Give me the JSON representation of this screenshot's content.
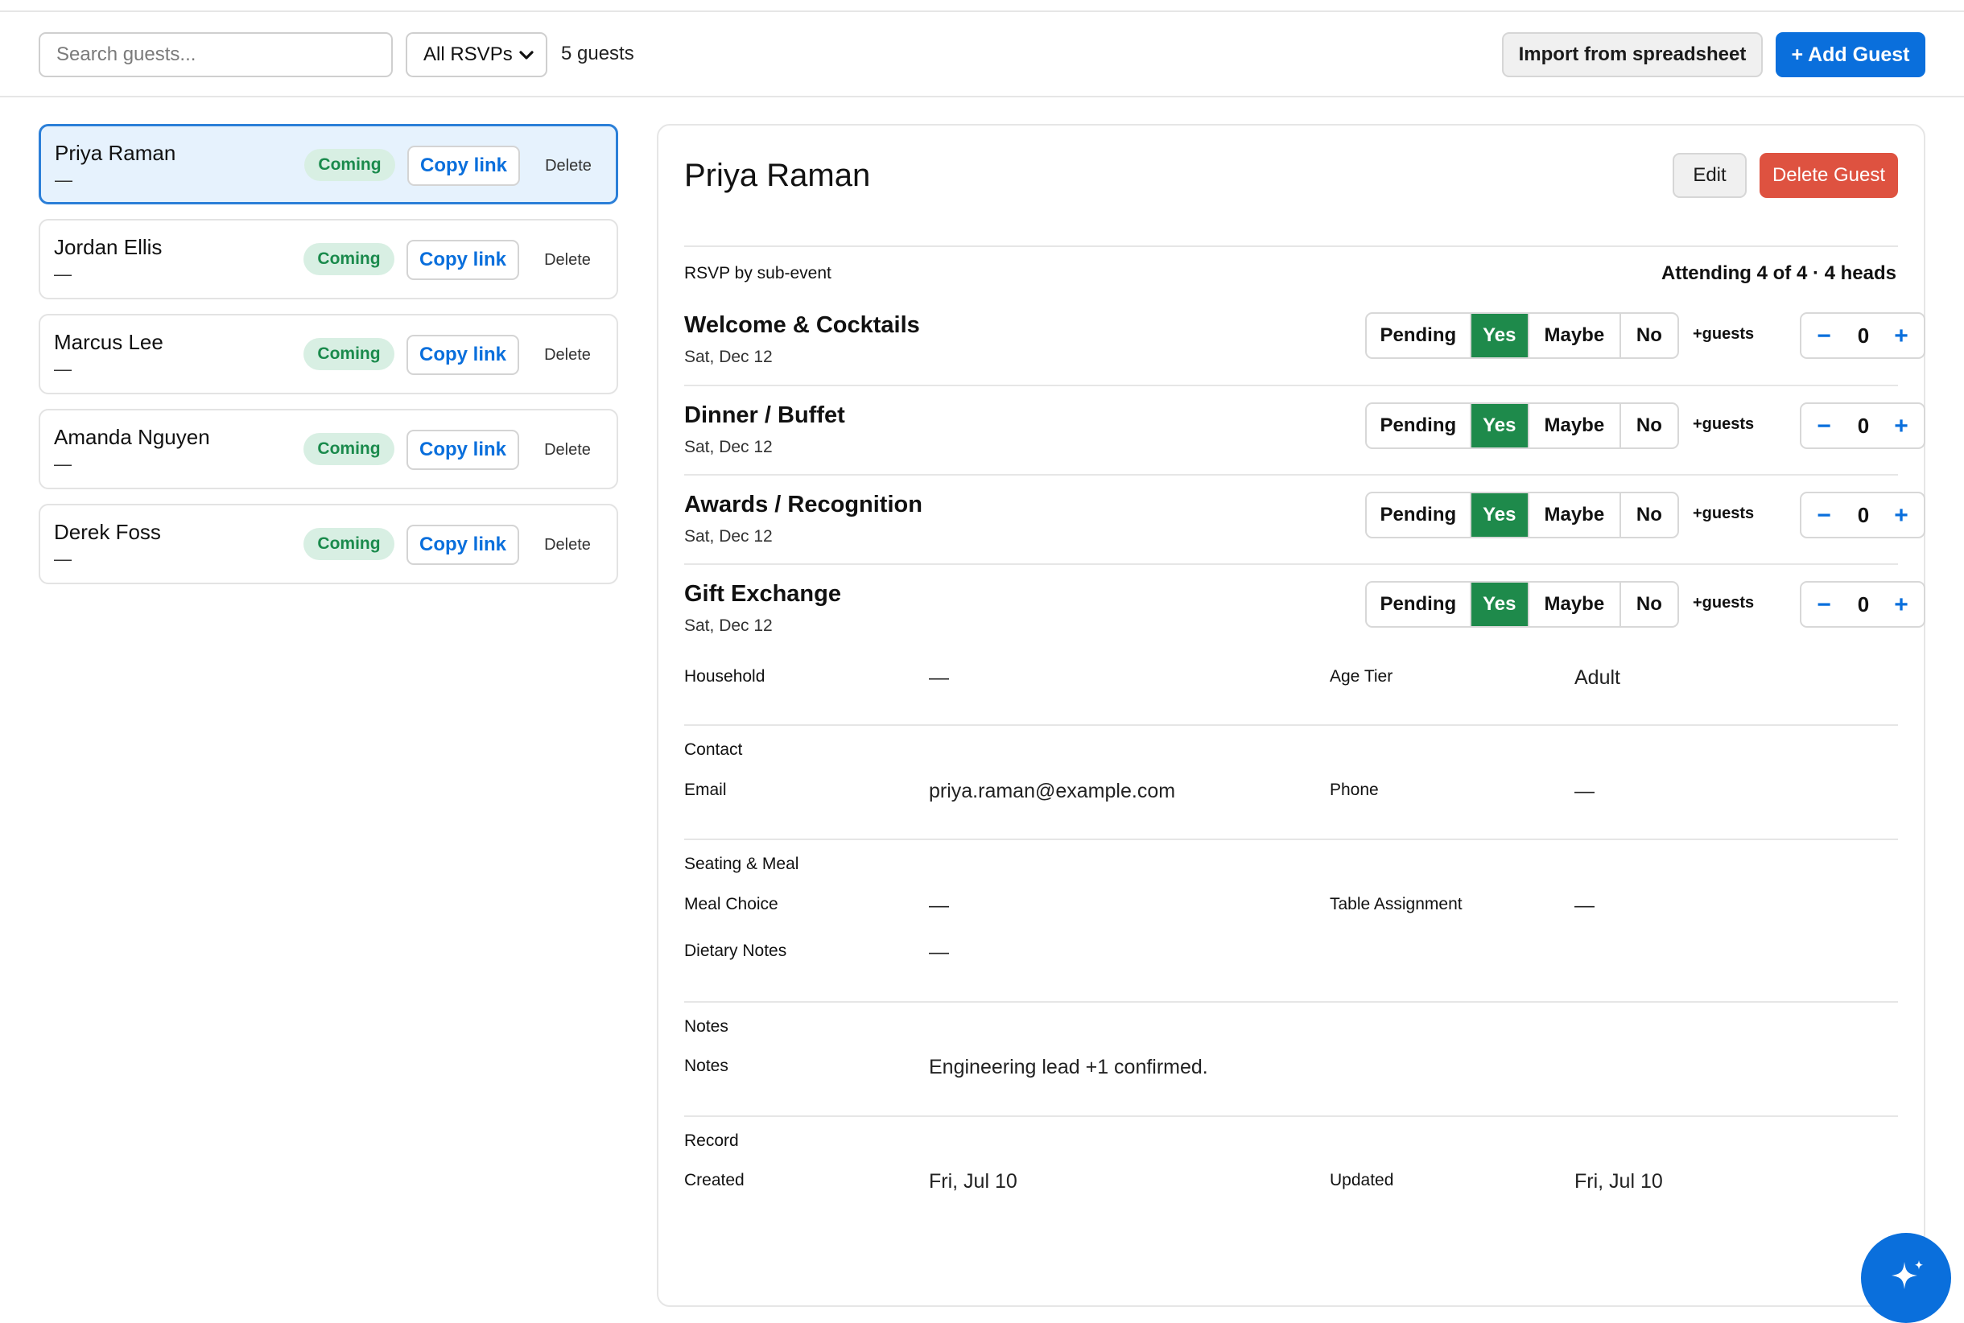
{
  "toolbar": {
    "search_placeholder": "Search guests...",
    "rsvp_filter": "All RSVPs",
    "guest_count": "5 guests",
    "import_label": "Import from spreadsheet",
    "add_label": "+ Add Guest"
  },
  "guests": [
    {
      "name": "Priya Raman",
      "sub": "—",
      "status": "Coming",
      "copy": "Copy link",
      "delete": "Delete"
    },
    {
      "name": "Jordan Ellis",
      "sub": "—",
      "status": "Coming",
      "copy": "Copy link",
      "delete": "Delete"
    },
    {
      "name": "Marcus Lee",
      "sub": "—",
      "status": "Coming",
      "copy": "Copy link",
      "delete": "Delete"
    },
    {
      "name": "Amanda Nguyen",
      "sub": "—",
      "status": "Coming",
      "copy": "Copy link",
      "delete": "Delete"
    },
    {
      "name": "Derek Foss",
      "sub": "—",
      "status": "Coming",
      "copy": "Copy link",
      "delete": "Delete"
    }
  ],
  "detail": {
    "name": "Priya Raman",
    "edit_label": "Edit",
    "delete_label": "Delete Guest",
    "rsvp_heading": "RSVP by sub-event",
    "attending": "Attending 4 of 4 · 4 heads",
    "rsvp_options": [
      "Pending",
      "Yes",
      "Maybe",
      "No"
    ],
    "plus_guests_label": "+guests",
    "events": [
      {
        "name": "Welcome & Cocktails",
        "date": "Sat, Dec 12",
        "selected": "Yes",
        "extra": "0"
      },
      {
        "name": "Dinner / Buffet",
        "date": "Sat, Dec 12",
        "selected": "Yes",
        "extra": "0"
      },
      {
        "name": "Awards / Recognition",
        "date": "Sat, Dec 12",
        "selected": "Yes",
        "extra": "0"
      },
      {
        "name": "Gift Exchange",
        "date": "Sat, Dec 12",
        "selected": "Yes",
        "extra": "0"
      }
    ],
    "household_label": "Household",
    "household_value": "—",
    "age_tier_label": "Age Tier",
    "age_tier_value": "Adult",
    "contact": {
      "title": "Contact",
      "email_label": "Email",
      "email_value": "priya.raman@example.com",
      "phone_label": "Phone",
      "phone_value": "—"
    },
    "seating": {
      "title": "Seating & Meal",
      "meal_label": "Meal Choice",
      "meal_value": "—",
      "table_label": "Table Assignment",
      "table_value": "—",
      "dietary_label": "Dietary Notes",
      "dietary_value": "—"
    },
    "notes": {
      "title": "Notes",
      "label": "Notes",
      "value": "Engineering lead +1 confirmed."
    },
    "record": {
      "title": "Record",
      "created_label": "Created",
      "created_value": "Fri, Jul 10",
      "updated_label": "Updated",
      "updated_value": "Fri, Jul 10"
    }
  },
  "colors": {
    "accent": "#0a6fdc",
    "yes": "#1e8a4b",
    "danger": "#de5240",
    "badge_bg": "#d8efe3",
    "selected_bg": "#e6f2fd"
  },
  "icons": {
    "fab": "sparkle-icon",
    "select": "chevron-down-icon",
    "minus": "minus-icon",
    "plus": "plus-icon"
  }
}
